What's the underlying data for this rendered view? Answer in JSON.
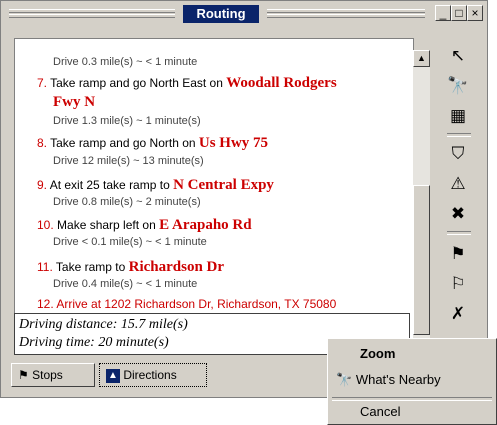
{
  "window": {
    "title": "Routing"
  },
  "steps": [
    {
      "sub": "Drive 0.3 mile(s) ~ < 1 minute"
    },
    {
      "num": "7.",
      "text": " Take ramp and go North East on ",
      "road1": "Woodall Rodgers",
      "road2": "Fwy N",
      "sub": "Drive 1.3 mile(s) ~ 1 minute(s)"
    },
    {
      "num": "8.",
      "text": " Take ramp and go North on ",
      "road": "Us Hwy 75",
      "sub": "Drive 12 mile(s) ~ 13 minute(s)"
    },
    {
      "num": "9.",
      "text": " At exit 25 take ramp to ",
      "road": "N Central Expy",
      "sub": "Drive 0.8 mile(s) ~ 2 minute(s)"
    },
    {
      "num": "10.",
      "text": " Make sharp left on ",
      "road": "E Arapaho Rd",
      "sub": "Drive < 0.1 mile(s) ~ < 1 minute"
    },
    {
      "num": "11.",
      "text": " Take ramp to ",
      "road": "Richardson Dr",
      "sub": "Drive 0.4 mile(s) ~ < 1 minute"
    },
    {
      "text": "12. Arrive at 1202 Richardson Dr, Richardson, TX 75080"
    }
  ],
  "summary": {
    "distance": "Driving distance: 15.7 mile(s)",
    "time": "Driving time: 20 minute(s)"
  },
  "tabs": [
    {
      "label": "Stops"
    },
    {
      "label": "Directions"
    }
  ],
  "context_menu": {
    "items": [
      {
        "label": "Zoom"
      },
      {
        "label": "What's Nearby"
      },
      {
        "label": "Cancel"
      }
    ]
  },
  "titlebar_buttons": {
    "minimize": "_",
    "maximize": "□",
    "close": "×"
  }
}
